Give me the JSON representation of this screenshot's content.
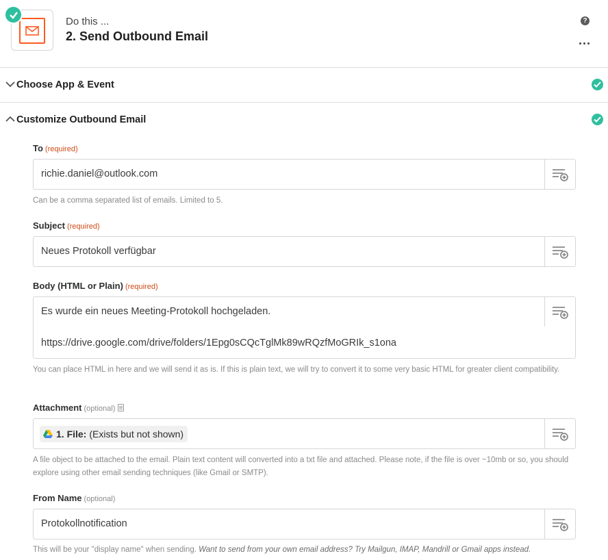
{
  "header": {
    "pre_title": "Do this ...",
    "title": "2. Send Outbound Email",
    "app_icon": "mail-icon",
    "help_icon": "question-icon",
    "more_icon": "more-dots-icon"
  },
  "sections": [
    {
      "label": "Choose App & Event",
      "state": "collapsed",
      "status_icon": "check-circle-icon"
    },
    {
      "label": "Customize Outbound Email",
      "state": "expanded",
      "status_icon": "check-circle-icon"
    }
  ],
  "fields": {
    "to": {
      "label": "To",
      "tag": "(required)",
      "value": "richie.daniel@outlook.com",
      "help": "Can be a comma separated list of emails. Limited to 5."
    },
    "subject": {
      "label": "Subject",
      "tag": "(required)",
      "value": "Neues Protokoll verfügbar"
    },
    "body": {
      "label": "Body (HTML or Plain)",
      "tag": "(required)",
      "line1": "Es wurde ein neues Meeting-Protokoll hochgeladen.",
      "line2": "https://drive.google.com/drive/folders/1Epg0sCQcTglMk89wRQzfMoGRIk_s1ona",
      "help": "You can place HTML in here and we will send it as is. If this is plain text, we will try to convert it to some very basic HTML for greater client compatibility."
    },
    "attachment": {
      "label": "Attachment",
      "tag": "(optional)",
      "pill_step": "1. File:",
      "pill_text": "(Exists but not shown)",
      "pill_icon": "google-drive-icon",
      "help": "A file object to be attached to the email. Plain text content will converted into a txt file and attached. Please note, if the file is over ~10mb or so, you should explore using other email sending techniques (like Gmail or SMTP)."
    },
    "from_name": {
      "label": "From Name",
      "tag": "(optional)",
      "value": "Protokollnotification",
      "help_plain": "This will be your \"display name\" when sending.",
      "help_italic": "Want to send from your own email address? Try Mailgun, IMAP, Mandrill or Gmail apps instead."
    }
  },
  "colors": {
    "accent_green": "#2fbf9f",
    "mail_orange": "#ff5a1f",
    "required_red": "#d14a16"
  }
}
